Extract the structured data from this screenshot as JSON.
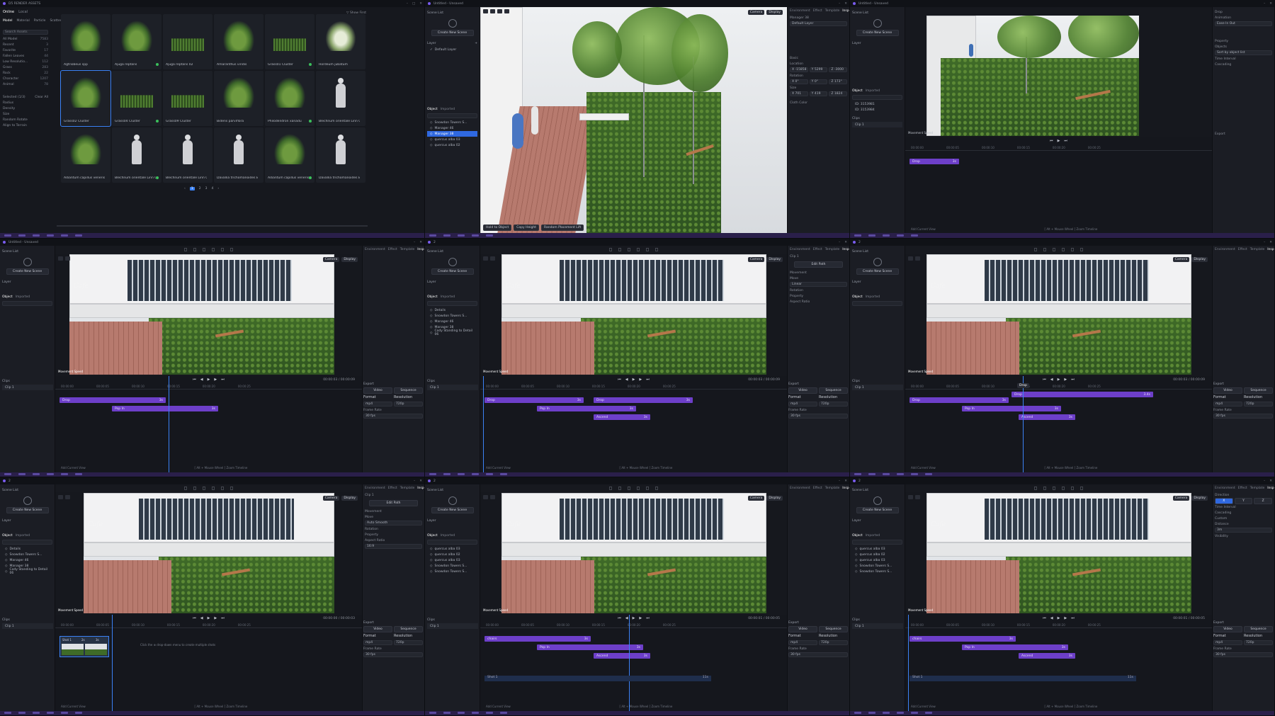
{
  "tiles": [
    {
      "id": "t1",
      "title": "D5 RENDER ASSETS",
      "top_tabs": [
        "Online",
        "Local"
      ],
      "category_tabs": [
        "Model",
        "Material",
        "Particle",
        "Scatter",
        "HDRI",
        "Terrain"
      ],
      "search_placeholder": "Search Assets",
      "sort_label": "Show First",
      "sidebar": [
        {
          "label": "All Model",
          "count": "7583"
        },
        {
          "label": "Recent",
          "count": "3"
        },
        {
          "label": "Favorite",
          "count": "17"
        },
        {
          "label": "Fallen Leaves",
          "count": "44"
        },
        {
          "label": "Low Resolutio...",
          "count": "112"
        },
        {
          "label": "Grass",
          "count": "283"
        },
        {
          "label": "Rock",
          "count": "22"
        },
        {
          "label": "Character",
          "count": "1207"
        },
        {
          "label": "Animal",
          "count": "78"
        }
      ],
      "brush": {
        "selected": "Selected (1/3)",
        "clear": "Clear All",
        "radius": "Radius",
        "density": "Density",
        "size": "Size",
        "random": "Random Rotate",
        "align": "Align to Terrain"
      },
      "assets": [
        {
          "name": "Agtriobeus spp",
          "kind": "plant"
        },
        {
          "name": "Ajuga reptans",
          "kind": "plant"
        },
        {
          "name": "Ajuga reptans 02",
          "kind": "grass"
        },
        {
          "name": "Amaranthus viridis",
          "kind": "plant"
        },
        {
          "name": "Grass01 Cluster",
          "kind": "grass"
        },
        {
          "name": "Hordeum jubatum",
          "kind": "white"
        },
        {
          "name": "Grass02 Cluster",
          "kind": "plant",
          "selected": true
        },
        {
          "name": "Grass04 Cluster",
          "kind": "grass"
        },
        {
          "name": "Grass09 Cluster",
          "kind": "grass"
        },
        {
          "name": "Bidens parviflora",
          "kind": "plant"
        },
        {
          "name": "Philodendron xanadu",
          "kind": "plant"
        },
        {
          "name": "Blechnum orientale Linn 02",
          "kind": "person"
        },
        {
          "name": "Adiantum capillus veneris ...",
          "kind": "plant"
        },
        {
          "name": "Blechnum orientale Linn 01",
          "kind": "person"
        },
        {
          "name": "Blechnum orientale Linn 03",
          "kind": "person"
        },
        {
          "name": "Davallia trichomanoides B...",
          "kind": "person"
        },
        {
          "name": "Adiantum capillus veneris ...",
          "kind": "plant"
        },
        {
          "name": "Davallia trichomanoides B...",
          "kind": "person"
        }
      ],
      "pages": [
        "1",
        "2",
        "3",
        "4"
      ]
    },
    {
      "id": "t2",
      "title": "Untitled - Unsaved",
      "scene_list": "Scene List",
      "create_scene": "Create New Scene",
      "layer": "Layer",
      "default_layer": "Default Layer",
      "object_tabs": [
        "Object",
        "Imported"
      ],
      "objects": [
        "Snowdon Towers S...",
        "Manager 46",
        "Manager 38",
        "quercus alba 03",
        "quercus alba 02"
      ],
      "selected_object": "Manager 38",
      "vp_buttons": [
        "Camera",
        "Display"
      ],
      "vp_foot": [
        "Hold to Object",
        "Copy Height",
        "Random Placement Lift"
      ],
      "inspector_tabs": [
        "Environment",
        "Effect",
        "Template",
        "Inspector"
      ],
      "inspector": {
        "name": "Manager 38",
        "layer": "Default Layer",
        "basic": "Basic",
        "location": "Location",
        "loc_vals": [
          "X -15858",
          "Y 5299",
          "Z -3000"
        ],
        "rotation": "Rotation",
        "rot_vals": [
          "X 0°",
          "Y 0°",
          "Z 173°"
        ],
        "size": "Size",
        "size_vals": [
          "X 701",
          "Y 419",
          "Z 1824"
        ],
        "cloth_color": "Cloth Color"
      }
    },
    {
      "id": "t3",
      "title": "Untitled - Unsaved",
      "objects": [
        "ID: 3153981",
        "ID: 3153984"
      ],
      "clips_label": "Clips",
      "clip1": "Clip 1",
      "movement_speed": "Movement Speed",
      "track": [
        {
          "label": "Drop",
          "dur": "3s"
        }
      ],
      "add_view": "Add Current View",
      "hint": "[ Alt + Mouse Wheel ] Zoom Timeline",
      "right": {
        "drop": "Drop",
        "animation": "Animation",
        "ease": "Ease In Out",
        "property": "Property",
        "objects": "Objects",
        "sort": "Sort by object list",
        "time_interval": "Time Interval",
        "cascading": "Cascading",
        "export": "Export"
      }
    },
    {
      "id": "t4",
      "title": "Untitled - Unsaved",
      "tc": "00:00:03 / 00:00:09",
      "tracks": [
        {
          "label": "Drop",
          "dur": "3s"
        },
        {
          "label": "Pop In",
          "dur": "3s"
        }
      ],
      "export": {
        "label": "Export",
        "tabs": [
          "Video",
          "Sequence"
        ],
        "format": "Format",
        "resolution": "Resolution",
        "fmt_val": "mp4",
        "res_val": "720p",
        "frame_rate": "Frame Rate"
      }
    },
    {
      "id": "t5",
      "title": "2",
      "objects": [
        "Details",
        "Snowdon Towers S...",
        "Manager 46",
        "Manager 38",
        "Cody Standing to Detail 06"
      ],
      "tc": "00:00:03 / 00:00:09",
      "tracks": [
        {
          "label": "Drop",
          "dur": "3s"
        },
        {
          "label": "Pop In",
          "dur": "3s"
        },
        {
          "label": "Drop",
          "dur": "3s"
        },
        {
          "label": "Ascend",
          "dur": "3s"
        }
      ],
      "inspector": {
        "clip": "Clip 1",
        "edit_path": "Edit Path",
        "movement": "Movement",
        "move": "Move",
        "linear": "Linear",
        "rotation": "Rotation",
        "property": "Property",
        "aspect": "Aspect Ratio",
        "export": "Export"
      }
    },
    {
      "id": "t6",
      "title": "2",
      "tc": "00:00:03 / 00:00:09",
      "tracks": [
        {
          "label": "Drop",
          "dur": "3s"
        },
        {
          "label": "Drop",
          "dur": "3.4s"
        },
        {
          "label": "Pop In",
          "dur": "3s"
        },
        {
          "label": "Ascend",
          "dur": "3s"
        }
      ],
      "tooltip": "Drop"
    },
    {
      "id": "t7",
      "title": "2",
      "objects": [
        "Details",
        "Snowdon Towers S...",
        "Manager 46",
        "Manager 38",
        "Cody Standing to Detail 06"
      ],
      "tc": "00:00:00 / 00:00:03",
      "shots": [
        "Shot 1",
        "2s",
        "3s"
      ],
      "drop_hint": "Click the  ⊕  drop-down menu to create multiple shots",
      "inspector": {
        "clip": "Clip 1",
        "edit_path": "Edit Path",
        "movement": "Movement",
        "move": "Move",
        "auto_smooth": "Auto Smooth",
        "rotation": "Rotation",
        "property": "Property",
        "aspect": "Aspect Ratio",
        "aspect_val": "16:9",
        "export": "Export",
        "fps": "30 fps"
      }
    },
    {
      "id": "t8",
      "title": "2",
      "objects": [
        "quercus alba 03",
        "quercus alba 02",
        "quercus alba 03",
        "Snowdon Towers S...",
        "Snowdon Towers S..."
      ],
      "tc": "00:00:01 / 00:00:05",
      "tracks": [
        {
          "label": "chairs",
          "dur": "3s"
        },
        {
          "label": "Pop In",
          "dur": "3s"
        },
        {
          "label": "Ascend",
          "dur": "3s"
        }
      ],
      "shot": "Shot 1",
      "shot_dur": "11s"
    },
    {
      "id": "t9",
      "title": "2",
      "objects": [
        "quercus alba 03",
        "quercus alba 02",
        "quercus alba 03",
        "Snowdon Towers S...",
        "Snowdon Towers S..."
      ],
      "tc": "00:00:01 / 00:00:05",
      "tracks": [
        {
          "label": "chairs",
          "dur": "3s"
        },
        {
          "label": "Pop In",
          "dur": "3s"
        },
        {
          "label": "Ascend",
          "dur": "3s"
        }
      ],
      "shot": "Shot 1",
      "shot_dur": "11s",
      "right": {
        "direction": "Direction",
        "axes": [
          "X",
          "Y",
          "Z"
        ],
        "time_interval": "Time Interval",
        "cascading": "Cascading",
        "custom": "Custom",
        "distance": "Distance",
        "distance_val": "3m",
        "visibility": "Visibility"
      }
    }
  ],
  "common": {
    "cafe_sign": "Cafe",
    "camera": "Camera",
    "display": "Display",
    "movement_speed": "Movement Speed",
    "clip1": "Clip 1",
    "clips": "Clips",
    "add_view": "Add Current View",
    "zoom_hint": "[ Alt + Mouse Wheel ] Zoom Timeline",
    "object": "Object",
    "imported": "Imported",
    "layer": "Layer",
    "scene_list": "Scene List",
    "create_scene": "Create New Scene",
    "export": "Export",
    "video": "Video",
    "sequence": "Sequence",
    "format": "Format",
    "resolution": "Resolution",
    "mp4": "mp4",
    "r720": "720p",
    "frame_rate": "Frame Rate",
    "fps": "30 fps",
    "env_tabs": [
      "Environment",
      "Effect",
      "Template",
      "Inspector"
    ]
  },
  "colors": {
    "accent": "#3b82f6",
    "clip": "#6d3fc9",
    "panel": "#1b1d24",
    "bg": "#16181e"
  }
}
